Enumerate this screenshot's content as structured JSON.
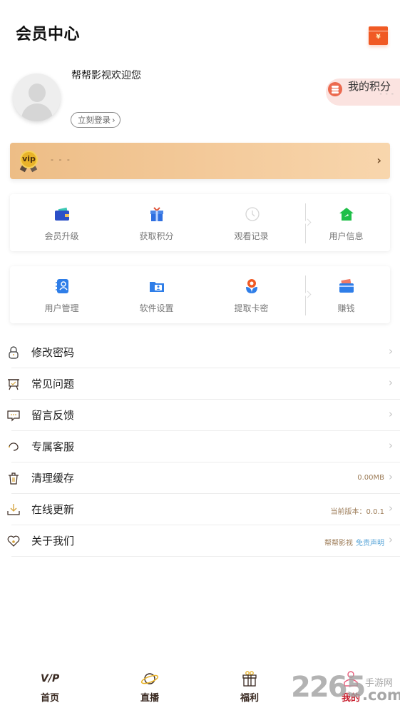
{
  "header": {
    "title": "会员中心",
    "red_packet_icon": "red-packet-yuan-icon",
    "red_packet_glyph": "¥"
  },
  "profile": {
    "welcome": "帮帮影视欢迎您",
    "login_label": "立刻登录",
    "login_chevron": "›",
    "avatar_icon": "default-avatar-icon"
  },
  "points": {
    "label": "我的积分",
    "value": "- - -",
    "icon": "coin-stack-icon"
  },
  "vip": {
    "badge": "vip",
    "status": "- - -",
    "chevron": "›"
  },
  "grid1": {
    "items": [
      {
        "label": "会员升级",
        "icon": "wallet-icon"
      },
      {
        "label": "获取积分",
        "icon": "gift-icon"
      },
      {
        "label": "观看记录",
        "icon": "history-clock-icon"
      },
      {
        "label": "用户信息",
        "icon": "home-icon"
      }
    ]
  },
  "grid2": {
    "items": [
      {
        "label": "用户管理",
        "icon": "contacts-book-icon"
      },
      {
        "label": "软件设置",
        "icon": "user-folder-icon"
      },
      {
        "label": "提取卡密",
        "icon": "flower-icon"
      },
      {
        "label": "赚钱",
        "icon": "card-wallet-icon"
      }
    ]
  },
  "menu": {
    "items": [
      {
        "label": "修改密码",
        "icon": "lock-icon",
        "right": ""
      },
      {
        "label": "常见问题",
        "icon": "easel-icon",
        "right": ""
      },
      {
        "label": "留言反馈",
        "icon": "chat-bubble-icon",
        "right": ""
      },
      {
        "label": "专属客服",
        "icon": "headset-icon",
        "right": ""
      },
      {
        "label": "清理缓存",
        "icon": "trash-icon",
        "right": "0.00MB"
      },
      {
        "label": "在线更新",
        "icon": "download-icon",
        "right": "当前版本：0.0.1"
      },
      {
        "label": "关于我们",
        "icon": "heart-icon",
        "right": "帮帮影视",
        "right_link": "免责声明"
      }
    ],
    "chevron": "›"
  },
  "tabbar": {
    "tabs": [
      {
        "label": "首页",
        "icon": "vip-logo-icon",
        "active": false
      },
      {
        "label": "直播",
        "icon": "planet-icon",
        "active": false
      },
      {
        "label": "福利",
        "icon": "gift-box-icon",
        "active": false
      },
      {
        "label": "我的",
        "icon": "user-profile-icon",
        "active": true
      }
    ],
    "home_icon_text": "V/P"
  },
  "watermark": {
    "number": "2265",
    "site_cn": "手游网",
    "domain": ".com"
  },
  "colors": {
    "accent_red": "#c8202f",
    "vip_gold": "#edbd86",
    "red_packet": "#f05a24",
    "link_blue": "#5aa6d8",
    "secondary_brown": "#9b7a55"
  }
}
